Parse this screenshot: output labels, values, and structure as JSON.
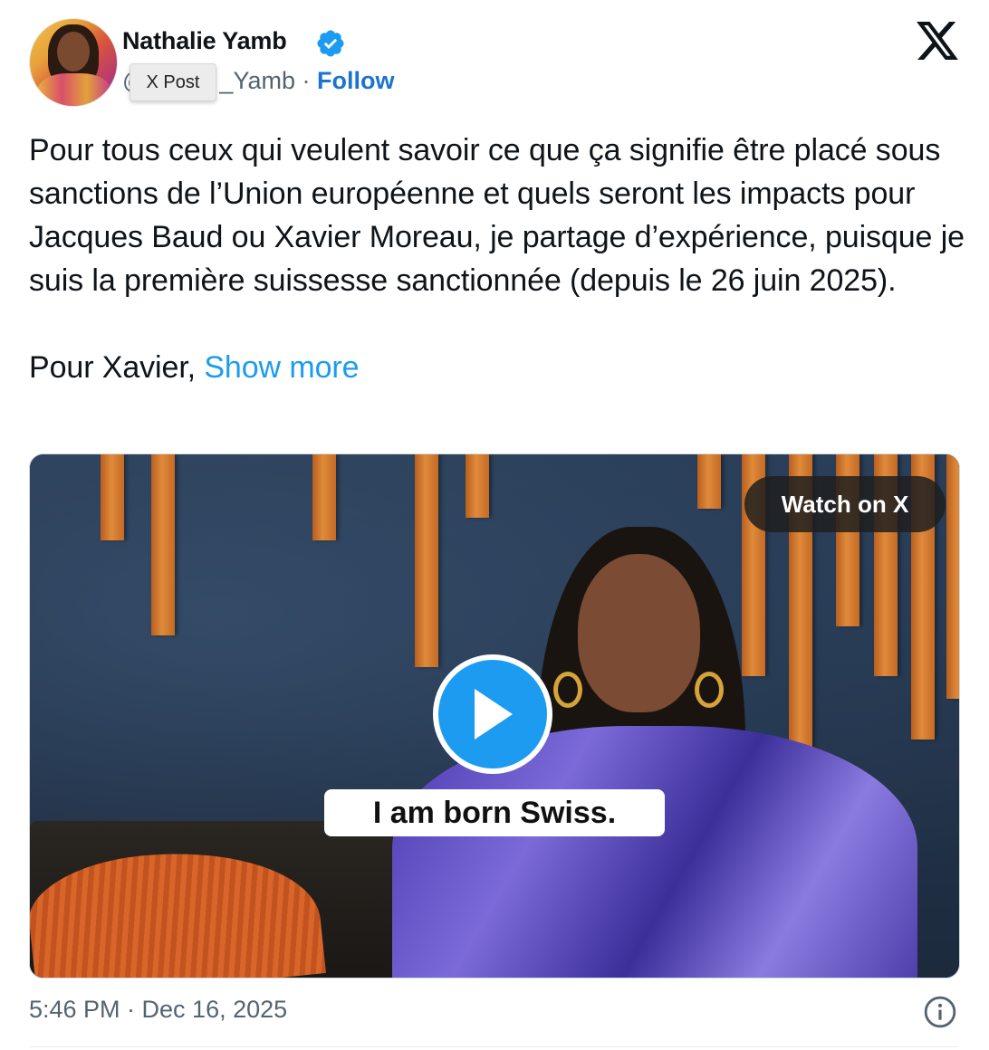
{
  "author": {
    "name": "Nathalie Yamb",
    "handle_visible": "@",
    "handle_tail": "_Yamb",
    "separator": "·",
    "follow_label": "Follow",
    "verified": true
  },
  "tooltip": {
    "label": "X Post"
  },
  "brand": {
    "logo": "x-logo-icon"
  },
  "tweet": {
    "paragraph1": "Pour tous ceux qui veulent savoir ce que ça signifie être placé sous sanctions de l’Union européenne et quels seront les impacts pour Jacques Baud ou Xavier Moreau, je partage d’expérience, puisque je suis la première suissesse sanctionnée (depuis le 26 juin 2025).",
    "paragraph2_start": "Pour Xavier, ",
    "show_more": "Show more"
  },
  "video": {
    "watch_label": "Watch on X",
    "caption": "I am born Swiss.",
    "play_icon": "play-icon"
  },
  "footer": {
    "timestamp": "5:46 PM · Dec 16, 2025",
    "info_icon": "info-icon"
  },
  "colors": {
    "accent": "#1d9bf0",
    "follow": "#1d74d0",
    "muted": "#536471",
    "text": "#0f1419"
  }
}
